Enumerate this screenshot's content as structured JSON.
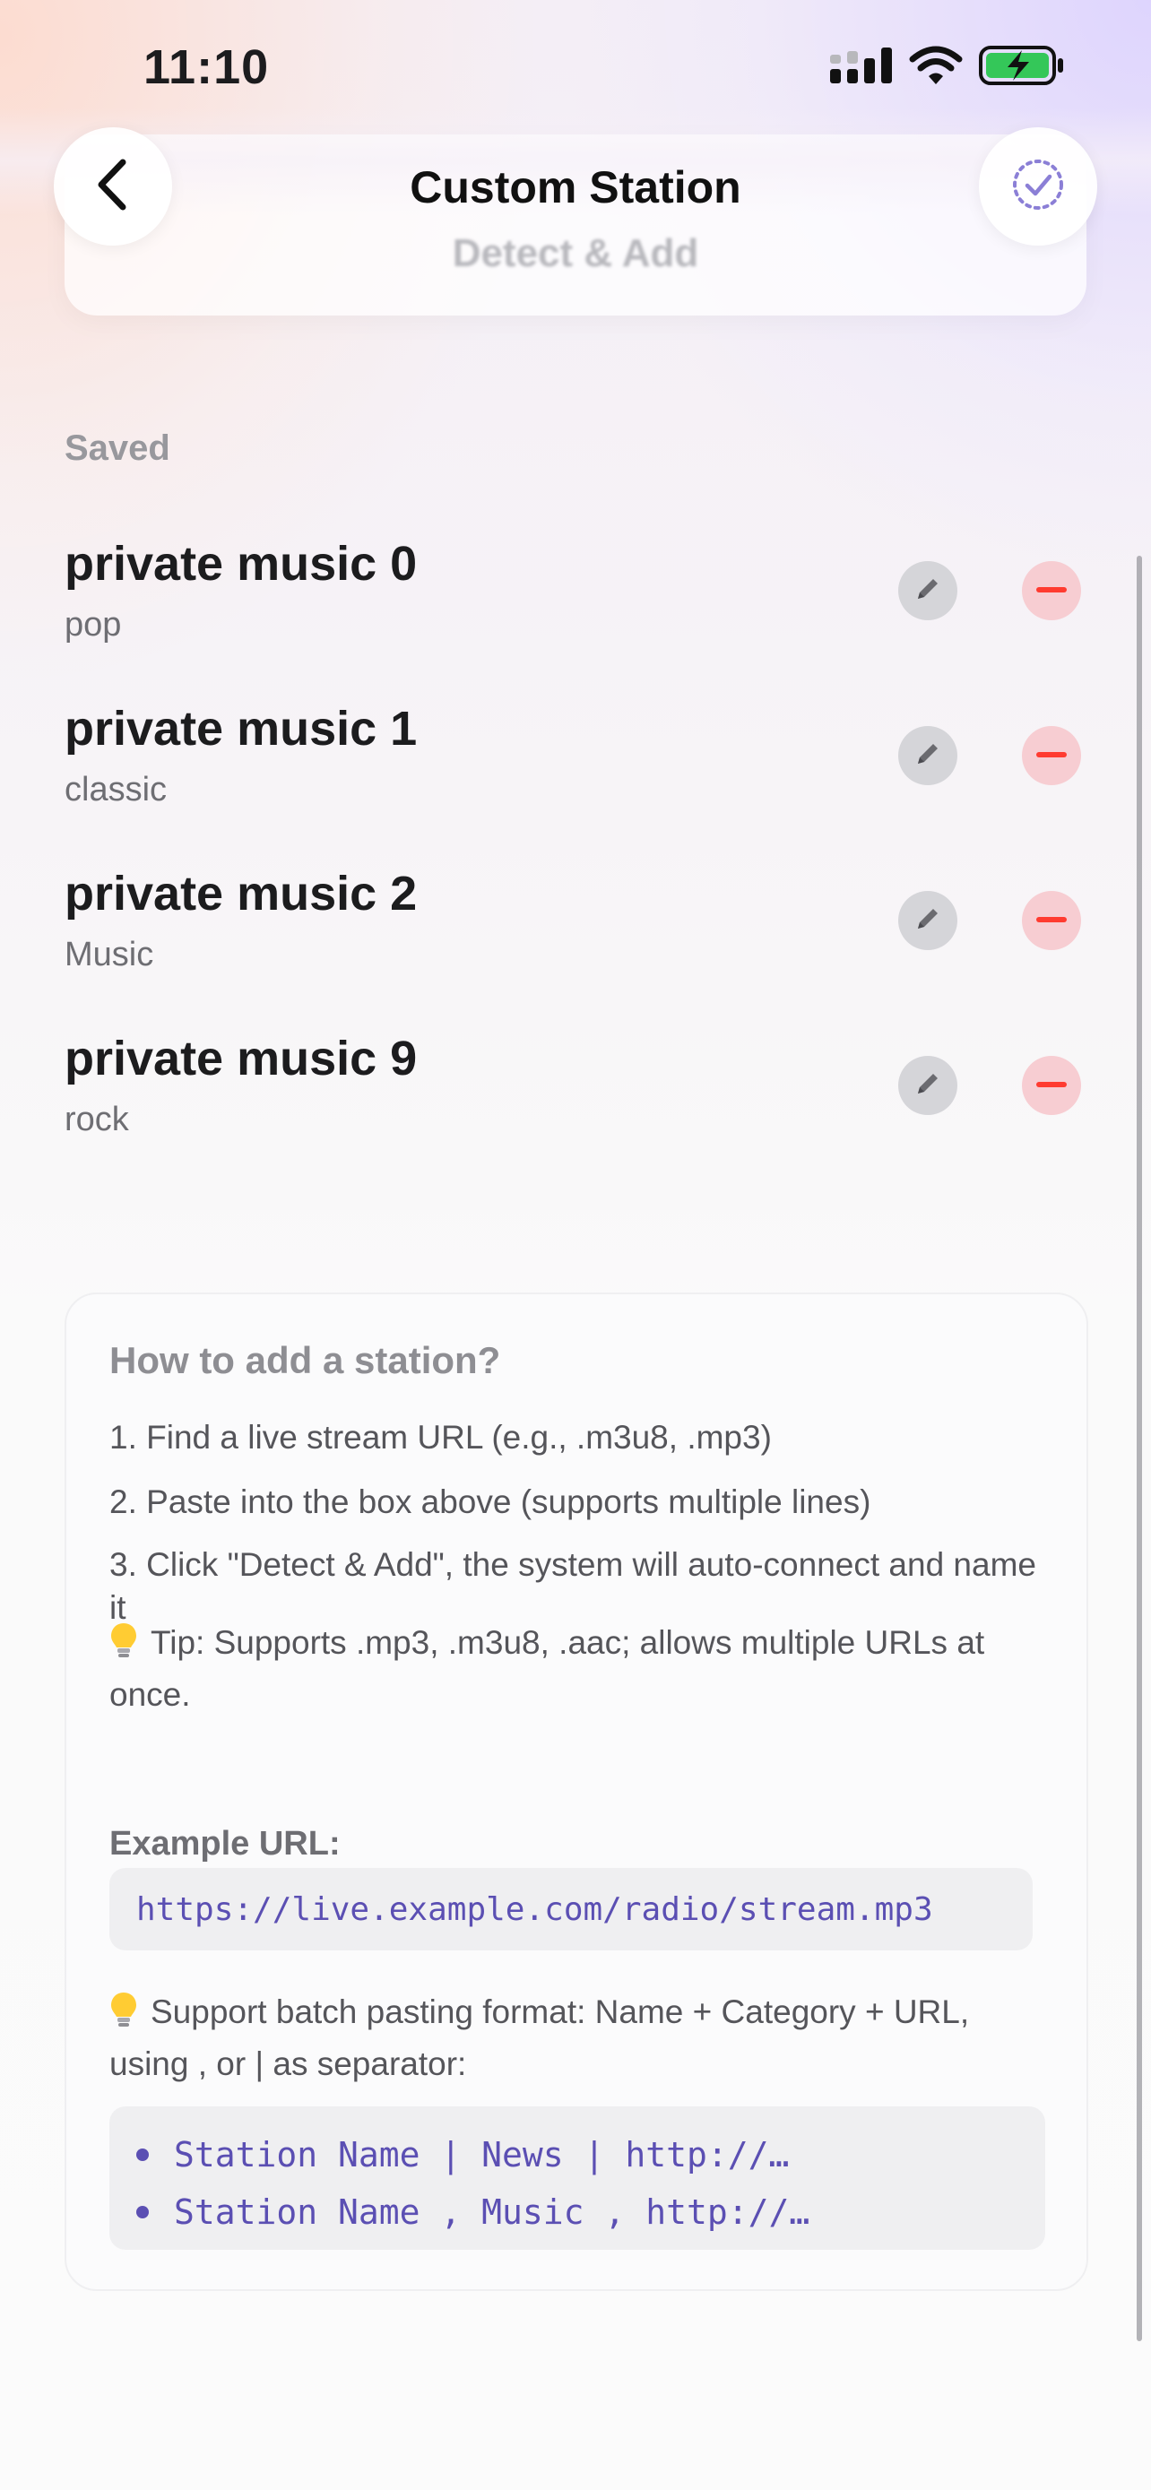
{
  "status_bar": {
    "time": "11:10",
    "icons": [
      "cellular-signal-icon",
      "wifi-icon",
      "battery-charging-icon"
    ],
    "battery_color": "#34c759"
  },
  "header": {
    "title": "Custom Station",
    "back_icon": "chevron-left-icon",
    "confirm_icon": "dashed-circle-check-icon"
  },
  "top_card": {
    "button_label": "Detect & Add"
  },
  "saved": {
    "section_label": "Saved",
    "stations": [
      {
        "name": "private music 0",
        "category": "pop"
      },
      {
        "name": "private music 1",
        "category": "classic"
      },
      {
        "name": "private music 2",
        "category": "Music"
      },
      {
        "name": "private music 9",
        "category": "rock"
      }
    ]
  },
  "help": {
    "title": "How to add a station?",
    "steps": [
      "1. Find a live stream URL (e.g., .m3u8, .mp3)",
      "2. Paste into the box above (supports multiple lines)",
      "3. Click \"Detect & Add\", the system will auto-connect and name it"
    ],
    "tip": "Tip: Supports .mp3, .m3u8, .aac; allows multiple URLs at once.",
    "example_label": "Example URL:",
    "example_url": "https://live.example.com/radio/stream.mp3",
    "batch_tip": "Support batch pasting format: Name + Category + URL, using , or | as separator:",
    "batch_examples": [
      "Station Name | News | http://…",
      "Station Name , Music , http://…"
    ]
  },
  "colors": {
    "accent": "#5b4fb3",
    "delete": "#ff3b30",
    "edit_bg": "#d5d5d9",
    "delete_bg": "#f7cdd2"
  }
}
